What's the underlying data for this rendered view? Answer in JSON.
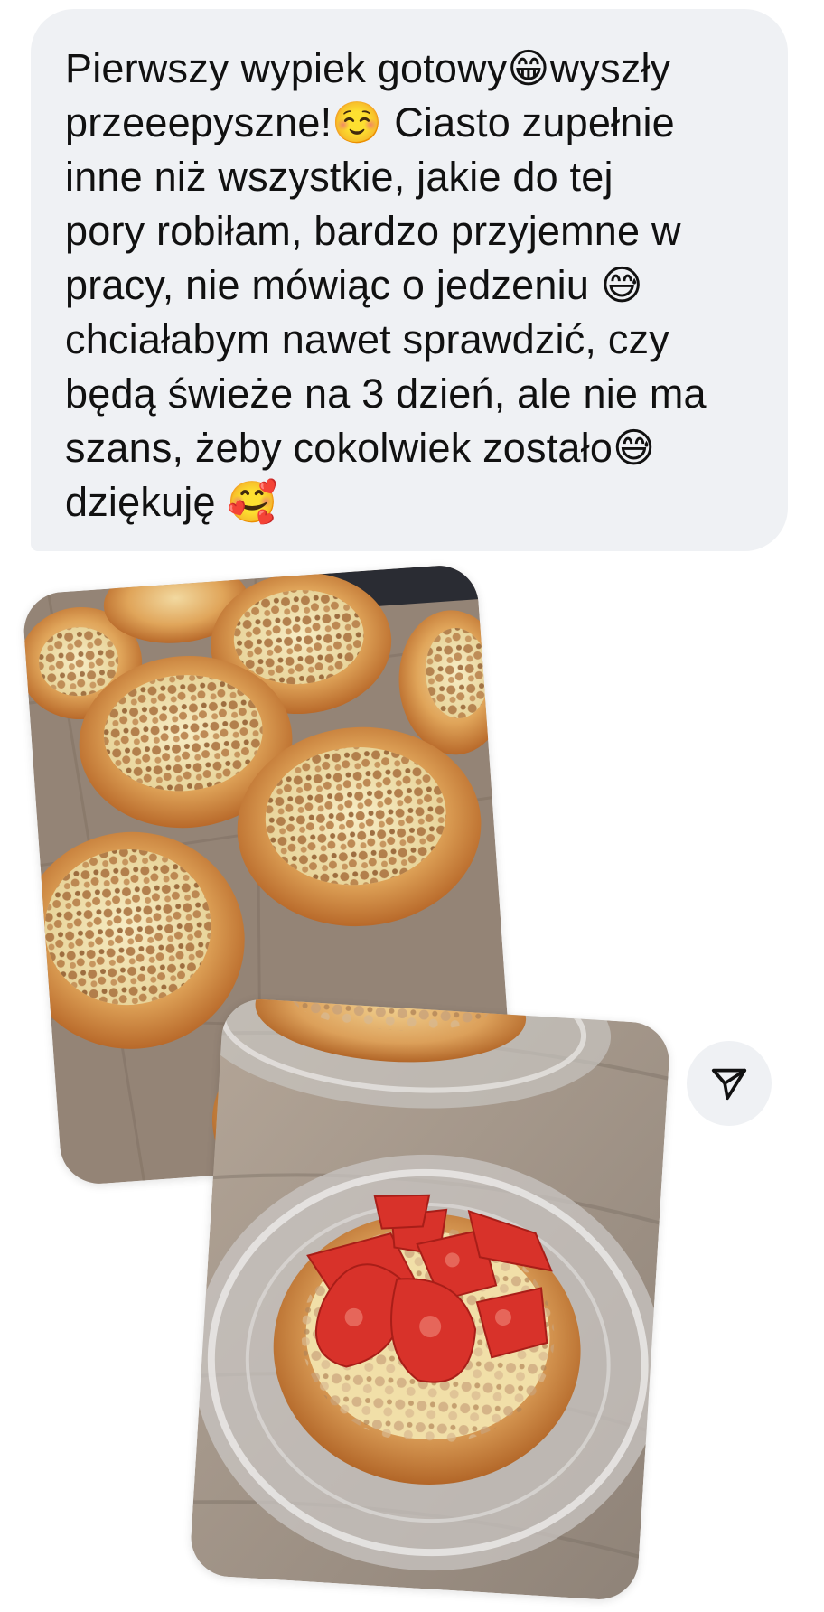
{
  "message": {
    "text": "Pierwszy wypiek gotowy😁wyszły\nprzeeepyszne!☺️ Ciasto zupełnie\ninne niż wszystkie, jakie do tej\npory robiłam, bardzo przyjemne w\npracy, nie mówiąc o jedzeniu 😅\nchciałabym nawet sprawdzić, czy\nbędą świeże na 3 dzień, ale nie ma\nszans, żeby cokolwiek zostało😅\ndziękuję 🥰"
  },
  "attachments": [
    {
      "icon": "photo-buns-on-tray"
    },
    {
      "icon": "photo-bun-with-strawberries"
    }
  ],
  "share": {
    "icon": "send-icon"
  },
  "colors": {
    "bubble": "#eff1f4",
    "text": "#111111",
    "strawberry": "#d8322a",
    "bun": "#d58a3a"
  }
}
